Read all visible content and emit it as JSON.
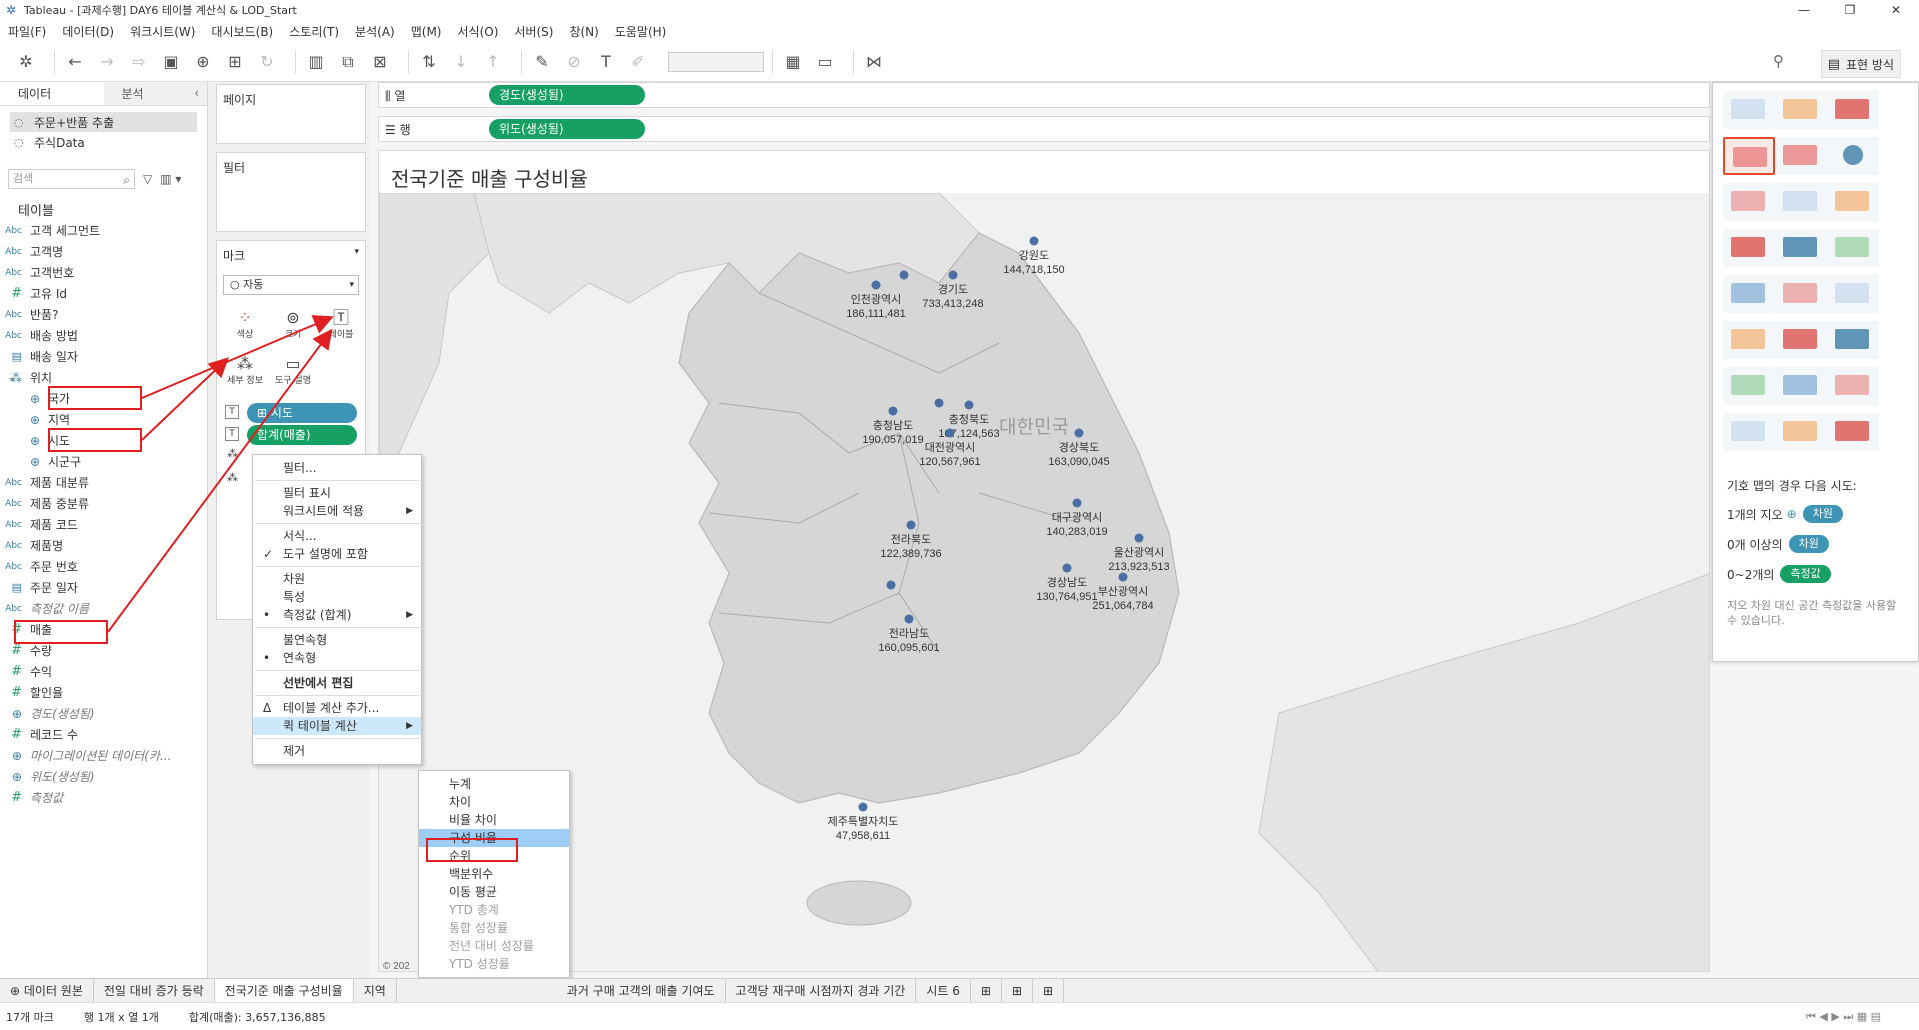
{
  "window": {
    "title": "Tableau - [과제수행] DAY6 테이블 계산식 & LOD_Start",
    "buttons": [
      "—",
      "❐",
      "✕"
    ]
  },
  "menubar": [
    "파일(F)",
    "데이터(D)",
    "워크시트(W)",
    "대시보드(B)",
    "스토리(T)",
    "분석(A)",
    "맵(M)",
    "서식(O)",
    "서버(S)",
    "창(N)",
    "도움말(H)"
  ],
  "toolbar": {
    "show_me_label": "표현 방식"
  },
  "data_pane": {
    "tab_data": "데이터",
    "tab_analysis": "분석",
    "sources": [
      "주문+반품 추출",
      "주식Data"
    ],
    "search_placeholder": "검색",
    "section_title": "테이블",
    "fields": [
      {
        "type": "Abc",
        "name": "고객 세그먼트"
      },
      {
        "type": "Abc",
        "name": "고객명"
      },
      {
        "type": "Abc",
        "name": "고객번호"
      },
      {
        "type": "#",
        "name": "고유 Id"
      },
      {
        "type": "Abc",
        "name": "반품?"
      },
      {
        "type": "Abc",
        "name": "배송 방법"
      },
      {
        "type": "date",
        "name": "배송 일자"
      },
      {
        "type": "hier",
        "name": "위치"
      },
      {
        "type": "geo",
        "name": "국가"
      },
      {
        "type": "geo",
        "name": "지역"
      },
      {
        "type": "geo",
        "name": "시도"
      },
      {
        "type": "geo",
        "name": "시군구"
      },
      {
        "type": "Abc",
        "name": "제품 대분류"
      },
      {
        "type": "Abc",
        "name": "제품 중분류"
      },
      {
        "type": "Abc",
        "name": "제품 코드"
      },
      {
        "type": "Abc",
        "name": "제품명"
      },
      {
        "type": "Abc",
        "name": "주문 번호"
      },
      {
        "type": "date",
        "name": "주문 일자"
      },
      {
        "type": "Abc",
        "name": "측정값 이름"
      },
      {
        "type": "#",
        "name": "매출"
      },
      {
        "type": "#",
        "name": "수량"
      },
      {
        "type": "#",
        "name": "수익"
      },
      {
        "type": "#",
        "name": "할인율"
      },
      {
        "type": "geo",
        "name": "경도(생성됨)"
      },
      {
        "type": "#",
        "name": "레코드 수"
      },
      {
        "type": "geo",
        "name": "마이그레이션된 데이터(카..."
      },
      {
        "type": "geo",
        "name": "위도(생성됨)"
      },
      {
        "type": "#",
        "name": "측정값"
      }
    ]
  },
  "cards": {
    "pages": "페이지",
    "filters": "필터",
    "marks": "마크",
    "marks_type": "자동",
    "mark_buttons": [
      "색상",
      "크기",
      "레이블",
      "세부 정보",
      "도구 설명"
    ],
    "pill_sido": "시도",
    "pill_sum": "합계(매출)"
  },
  "shelves": {
    "columns_label": "열",
    "rows_label": "행",
    "columns_pill": "경도(생성됨)",
    "rows_pill": "위도(생성됨)"
  },
  "view": {
    "title": "전국기준 매출 구성비율",
    "country_label": "대한민국",
    "copyright": "© 202",
    "regions": [
      {
        "name": "강원도",
        "value": "144,718,150"
      },
      {
        "name": "경기도",
        "value": "733,413,248"
      },
      {
        "name": "인천광역시",
        "value": "186,111,481"
      },
      {
        "name": "충청북도",
        "value": "107,124,563"
      },
      {
        "name": "충청남도",
        "value": "190,057,019"
      },
      {
        "name": "대전광역시",
        "value": "120,567,961"
      },
      {
        "name": "경상북도",
        "value": "163,090,045"
      },
      {
        "name": "대구광역시",
        "value": "140,283,019"
      },
      {
        "name": "전라북도",
        "value": "122,389,736"
      },
      {
        "name": "울산광역시",
        "value": "213,923,513"
      },
      {
        "name": "경상남도",
        "value": "130,764,951"
      },
      {
        "name": "부산광역시",
        "value": "251,064,784"
      },
      {
        "name": "전라남도",
        "value": "160,095,601"
      },
      {
        "name": "제주특별자치도",
        "value": "47,958,611"
      }
    ]
  },
  "show_me": {
    "hint_title": "기호 맵의 경우 다음 시도:",
    "row1_text": "1개의 지오",
    "row1_chip": "차원",
    "row2_text": "0개 이상의",
    "row2_chip": "차원",
    "row3_text": "0~2개의",
    "row3_chip": "측정값",
    "footer": "지오 차원 대신 공간 측정값을 사용할 수 있습니다."
  },
  "context_menu": {
    "items": [
      "필터...",
      "필터 표시",
      "워크시트에 적용",
      "서식...",
      "도구 설명에 포함",
      "차원",
      "특성",
      "측정값 (합계)",
      "불연속형",
      "연속형",
      "선반에서 편집",
      "테이블 계산 추가...",
      "퀵 테이블 계산",
      "제거"
    ]
  },
  "submenu": {
    "items": [
      "누계",
      "차이",
      "비율 차이",
      "구성 비율",
      "순위",
      "백분위수",
      "이동 평균",
      "YTD 총계",
      "통합 성장률",
      "전년 대비 성장률",
      "YTD 성장률"
    ]
  },
  "sheet_tabs": [
    "데이터 원본",
    "전일 대비 증가 등락",
    "전국기준 매출 구성비율",
    "지역",
    "과거 구매 고객의 매출 기여도",
    "고객당 재구매 시점까지 경과 기간",
    "시트 6"
  ],
  "status": {
    "marks": "17개 마크",
    "rows_cols": "행 1개 x 열 1개",
    "sum": "합계(매출): 3,657,136,885"
  },
  "colors": {
    "dimension_pill": "#3e94b5",
    "measure_pill": "#16a064",
    "highlight": "#e02020",
    "map_dot": "#4a6fa5"
  }
}
